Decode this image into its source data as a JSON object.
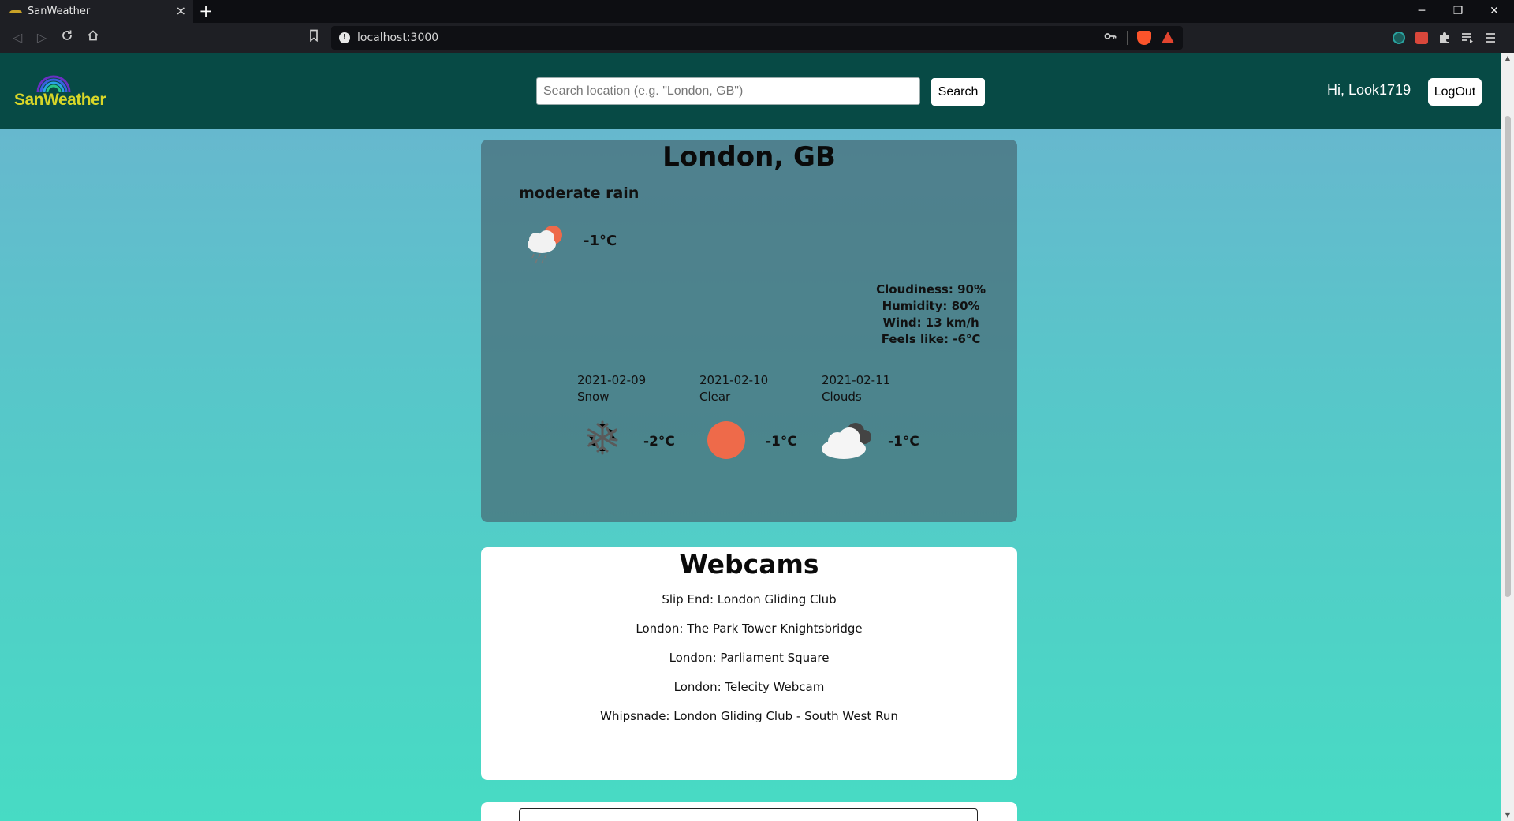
{
  "browser": {
    "tab_title": "SanWeather",
    "tab_close": "×",
    "new_tab": "+",
    "url": "localhost:3000",
    "window_controls": {
      "minimize": "─",
      "restore": "❐",
      "close": "✕"
    }
  },
  "header": {
    "logo_text": "SanWeather",
    "search_placeholder": "Search location (e.g. \"London, GB\")",
    "search_button": "Search",
    "greeting": "Hi, Look1719",
    "logout_button": "LogOut"
  },
  "weather": {
    "city": "London, GB",
    "description": "moderate rain",
    "current_icon": "rain-cloud-sun-icon",
    "current_temp": "-1°C",
    "details": {
      "cloudiness": "Cloudiness: 90%",
      "humidity": "Humidity: 80%",
      "wind": "Wind: 13 km/h",
      "feels_like": "Feels like: -6°C"
    },
    "forecast": [
      {
        "date": "2021-02-09",
        "condition": "Snow",
        "icon": "snowflake-icon",
        "temp": "-2°C"
      },
      {
        "date": "2021-02-10",
        "condition": "Clear",
        "icon": "sun-icon",
        "temp": "-1°C"
      },
      {
        "date": "2021-02-11",
        "condition": "Clouds",
        "icon": "clouds-icon",
        "temp": "-1°C"
      }
    ]
  },
  "webcams": {
    "title": "Webcams",
    "items": [
      "Slip End: London Gliding Club",
      "London: The Park Tower Knightsbridge",
      "London: Parliament Square",
      "London: Telecity Webcam",
      "Whipsnade: London Gliding Club - South West Run"
    ]
  },
  "colors": {
    "header_bg": "#074a45",
    "logo_text": "#d8d628",
    "sun": "#ee6a4a",
    "card_bg": "#4a7f89"
  }
}
